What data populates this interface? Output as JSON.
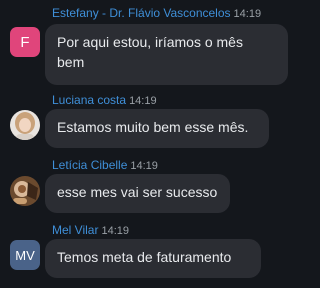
{
  "messages": [
    {
      "sender": "Estefany - Dr. Flávio Vasconcelos",
      "time": "14:19",
      "avatar_text": "F",
      "avatar_color": "#e0457b",
      "lines": [
        "Por aqui estou, iríamos o mês",
        "bem"
      ]
    },
    {
      "sender": "Luciana costa",
      "time": "14:19",
      "avatar_text": "",
      "avatar_icon": "profile-photo",
      "lines": [
        "Estamos muito bem esse mês."
      ]
    },
    {
      "sender": "Letícia Cibelle",
      "time": "14:19",
      "avatar_text": "",
      "avatar_icon": "profile-photo",
      "lines": [
        "esse mes vai ser sucesso"
      ]
    },
    {
      "sender": "Mel Vilar",
      "time": "14:19",
      "avatar_text": "MV",
      "avatar_color": "#4a6389",
      "lines": [
        "Temos meta de faturamento"
      ]
    }
  ],
  "colors": {
    "background": "#14171c",
    "bubble": "#2b2d33",
    "sender_name": "#3f8fd8",
    "timestamp": "#9aa0a6",
    "message_text": "#e8eaed"
  }
}
